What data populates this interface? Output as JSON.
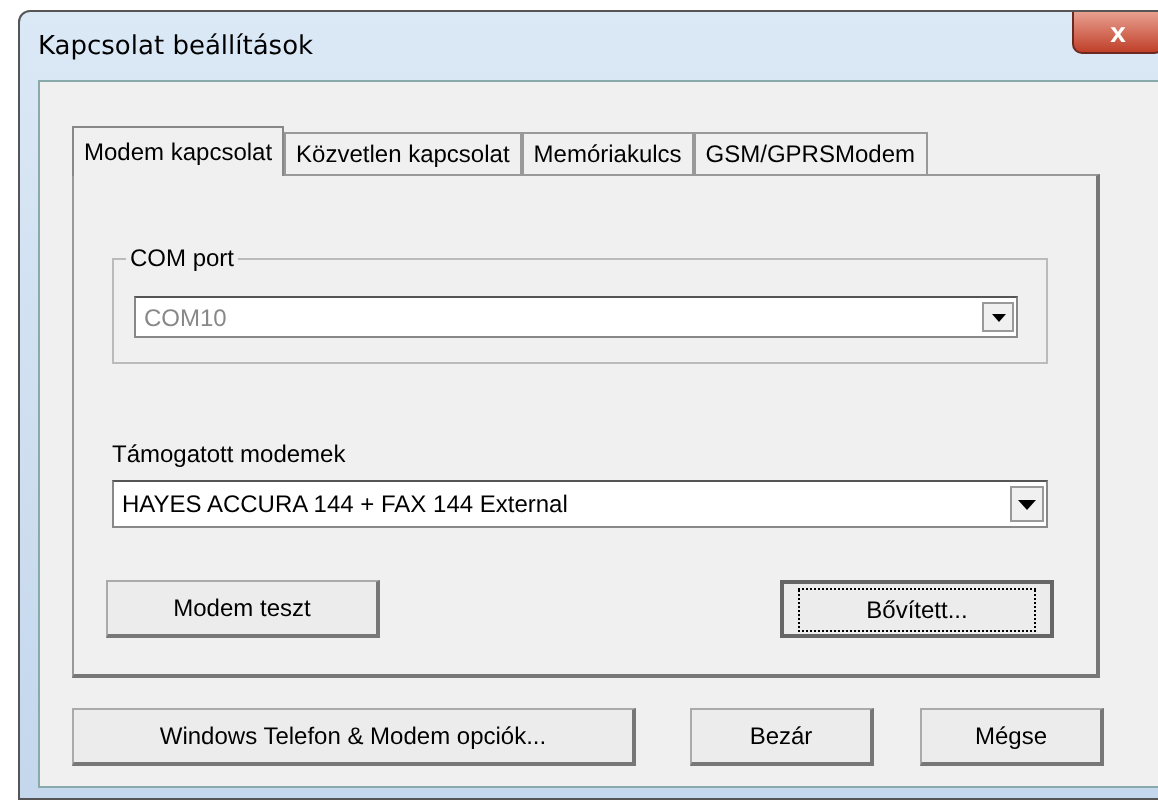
{
  "window": {
    "title": "Kapcsolat beállítások",
    "close": "x"
  },
  "tabs": [
    {
      "label": "Modem kapcsolat",
      "selected": true
    },
    {
      "label": "Közvetlen kapcsolat",
      "selected": false
    },
    {
      "label": "Memóriakulcs",
      "selected": false
    },
    {
      "label": "GSM/GPRSModem",
      "selected": false
    }
  ],
  "com_port": {
    "label": "COM port",
    "value": "COM10",
    "disabled": true
  },
  "modems": {
    "label": "Támogatott modemek",
    "value": "HAYES ACCURA 144 + FAX 144 External",
    "disabled": false
  },
  "panel_buttons": [
    {
      "label": "Modem teszt",
      "focused": false
    },
    {
      "label": "Bővített...",
      "focused": true
    }
  ],
  "buttons": [
    "Windows Telefon & Modem opciók...",
    "Bezár",
    "Mégse"
  ]
}
